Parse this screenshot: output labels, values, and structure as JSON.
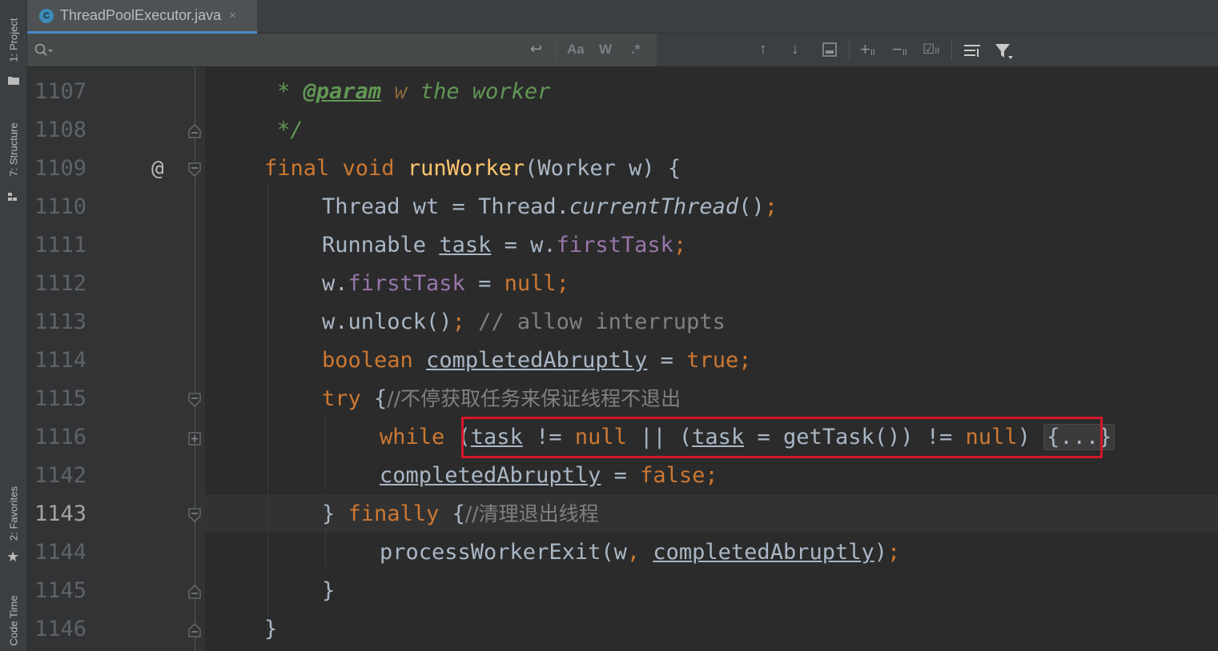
{
  "side_tabs": {
    "project": "1: Project",
    "structure": "7: Structure",
    "favorites": "2: Favorites",
    "code_time": "Code Time"
  },
  "tab": {
    "icon_letter": "C",
    "filename": "ThreadPoolExecutor.java",
    "close": "×"
  },
  "search_toolbar": {
    "match_case": "Aa",
    "words": "W",
    "regex": ".*"
  },
  "gutter": {
    "annotation_marker": "@",
    "line_numbers": [
      "1107",
      "1108",
      "1109",
      "1110",
      "1111",
      "1112",
      "1113",
      "1114",
      "1115",
      "1116",
      "1142",
      "1143",
      "1144",
      "1145",
      "1146"
    ],
    "current_line": "1143"
  },
  "code": {
    "l1107": {
      "star": "* ",
      "tag": "@param",
      "var": " w",
      "desc": " the worker"
    },
    "l1108": {
      "close": "*/"
    },
    "l1109": {
      "kw1": "final",
      "kw2": " void",
      "fn": " runWorker",
      "rest": "(Worker w) {"
    },
    "l1110": {
      "a": "Thread wt = Thread.",
      "m": "currentThread",
      "b": "()",
      "semi": ";"
    },
    "l1111": {
      "a": "Runnable ",
      "v": "task",
      "b": " = w.",
      "fld": "firstTask",
      "semi": ";"
    },
    "l1112": {
      "a": "w.",
      "fld": "firstTask",
      "b": " = ",
      "k": "null",
      "semi": ";"
    },
    "l1113": {
      "a": "w.unlock()",
      "semi": ";",
      "cm": " // allow interrupts"
    },
    "l1114": {
      "k": "boolean",
      "sp": " ",
      "v": "completedAbruptly",
      "b": " = ",
      "k2": "true",
      "semi": ";"
    },
    "l1115": {
      "k": "try",
      "b": " {",
      "cm": "//不停获取任务来保证线程不退出"
    },
    "l1116": {
      "k": "while",
      "a": " (",
      "v1": "task",
      "b": " != ",
      "k2": "null",
      "c": " || (",
      "v2": "task",
      "d": " = getTask()) != ",
      "k3": "null",
      "e": ")",
      "folded": "{...}"
    },
    "l1142": {
      "v": "completedAbruptly",
      "b": " = ",
      "k": "false",
      "semi": ";"
    },
    "l1143": {
      "a": "} ",
      "k": "finally",
      "b": " {",
      "cm": "//清理退出线程"
    },
    "l1144": {
      "a": "processWorkerExit(w",
      "comma": ",",
      "sp": " ",
      "v": "completedAbruptly",
      "b": ")",
      "semi": ";"
    },
    "l1145": {
      "a": "}"
    },
    "l1146": {
      "a": "}"
    }
  }
}
